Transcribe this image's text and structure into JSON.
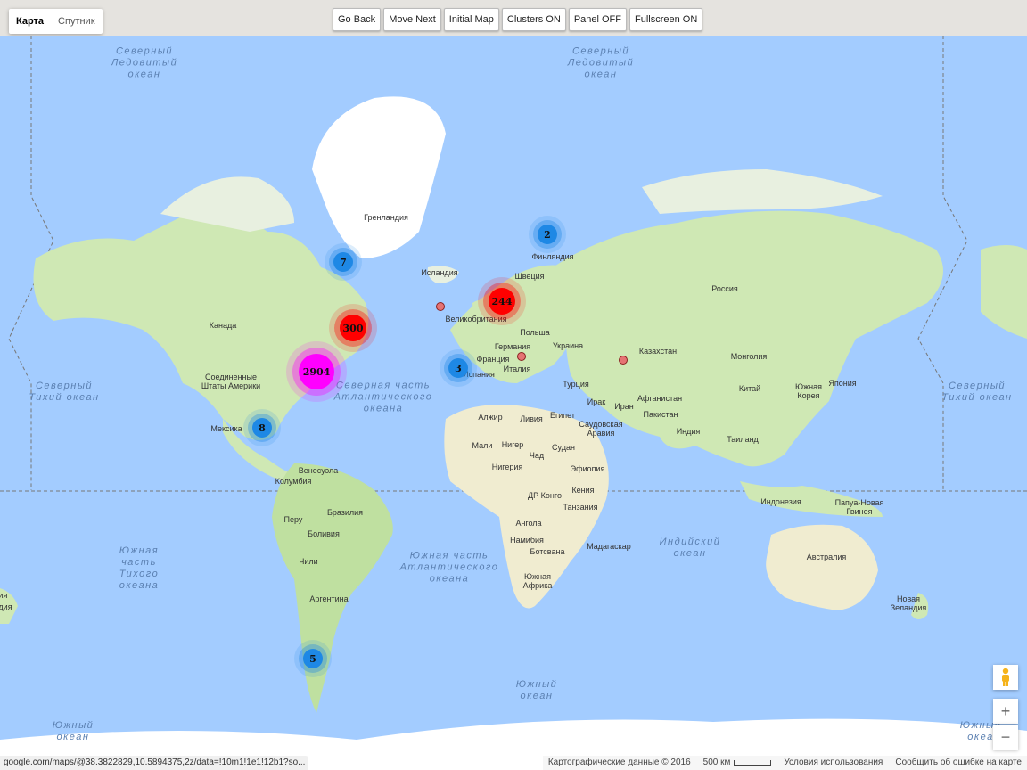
{
  "map_type": {
    "map": "Карта",
    "satellite": "Спутник"
  },
  "controls": [
    "Go Back",
    "Move Next",
    "Initial Map",
    "Clusters ON",
    "Panel OFF",
    "Fullscreen ON"
  ],
  "oceans": {
    "arctic_left": "Северный\nЛедовитый\nокеан",
    "arctic_right": "Северный\nЛедовитый\nокеан",
    "pacific_north_left": "Северный\nТихий океан",
    "pacific_north_right": "Северный\nТихий океан",
    "atlantic_north": "Северная часть\nАтлантического\nокеана",
    "atlantic_south": "Южная часть\nАтлантического\nокеана",
    "pacific_south": "Южная\nчасть\nТихого\nокеана",
    "indian": "Индийский\nокеан",
    "southern": "Южный\nокеан",
    "southern_left": "Южный\nокеан",
    "southern_right": "Южный\nокеа"
  },
  "countries": {
    "greenland": "Гренландия",
    "iceland": "Исландия",
    "finland": "Финляндия",
    "sweden": "Швеция",
    "uk": "Великобритания",
    "russia": "Россия",
    "canada": "Канада",
    "usa": "Соединенные\nШтаты Америки",
    "mexico": "Мексика",
    "poland": "Польша",
    "germany": "Германия",
    "ukraine": "Украина",
    "france": "Франция",
    "spain": "Испания",
    "italy": "Италия",
    "kazakhstan": "Казахстан",
    "mongolia": "Монголия",
    "turkey": "Турция",
    "china": "Китай",
    "korea": "Южная\nКорея",
    "japan": "Япония",
    "iraq": "Ирак",
    "iran": "Иран",
    "afghanistan": "Афганистан",
    "pakistan": "Пакистан",
    "india": "Индия",
    "thailand": "Таиланд",
    "algeria": "Алжир",
    "libya": "Ливия",
    "egypt": "Египет",
    "saudi": "Саудовская\nАравия",
    "mali": "Мали",
    "niger": "Нигер",
    "chad": "Чад",
    "sudan": "Судан",
    "nigeria": "Нигерия",
    "ethiopia": "Эфиопия",
    "drc": "ДР Конго",
    "kenya": "Кения",
    "tanzania": "Танзания",
    "angola": "Ангола",
    "namibia": "Намибия",
    "botswana": "Ботсвана",
    "south_africa": "Южная\nАфрика",
    "madagascar": "Мадагаскар",
    "venezuela": "Венесуэла",
    "colombia": "Колумбия",
    "peru": "Перу",
    "brazil": "Бразилия",
    "bolivia": "Боливия",
    "chile": "Чили",
    "argentina": "Аргентина",
    "indonesia": "Индонезия",
    "png": "Папуа-Новая\nГвинея",
    "australia": "Австралия",
    "new_zealand": "Новая\nЗеландия",
    "cut_left": "ия\nдия"
  },
  "clusters": [
    {
      "count": "2904",
      "color": "#ff00ff"
    },
    {
      "count": "300",
      "color": "#ff0000"
    },
    {
      "count": "244",
      "color": "#ff0000"
    },
    {
      "count": "7",
      "color": "#1e88e5"
    },
    {
      "count": "2",
      "color": "#1e88e5"
    },
    {
      "count": "3",
      "color": "#1e88e5"
    },
    {
      "count": "8",
      "color": "#1e88e5"
    },
    {
      "count": "5",
      "color": "#1e88e5"
    }
  ],
  "zoom": {
    "in": "+",
    "out": "−"
  },
  "footer": {
    "url": "google.com/maps/@38.3822829,10.5894375,2z/data=!10m1!1e1!12b1?so...",
    "data": "Картографические данные © 2016",
    "scale": "500 км",
    "terms": "Условия использования",
    "report": "Сообщить об ошибке на карте"
  }
}
